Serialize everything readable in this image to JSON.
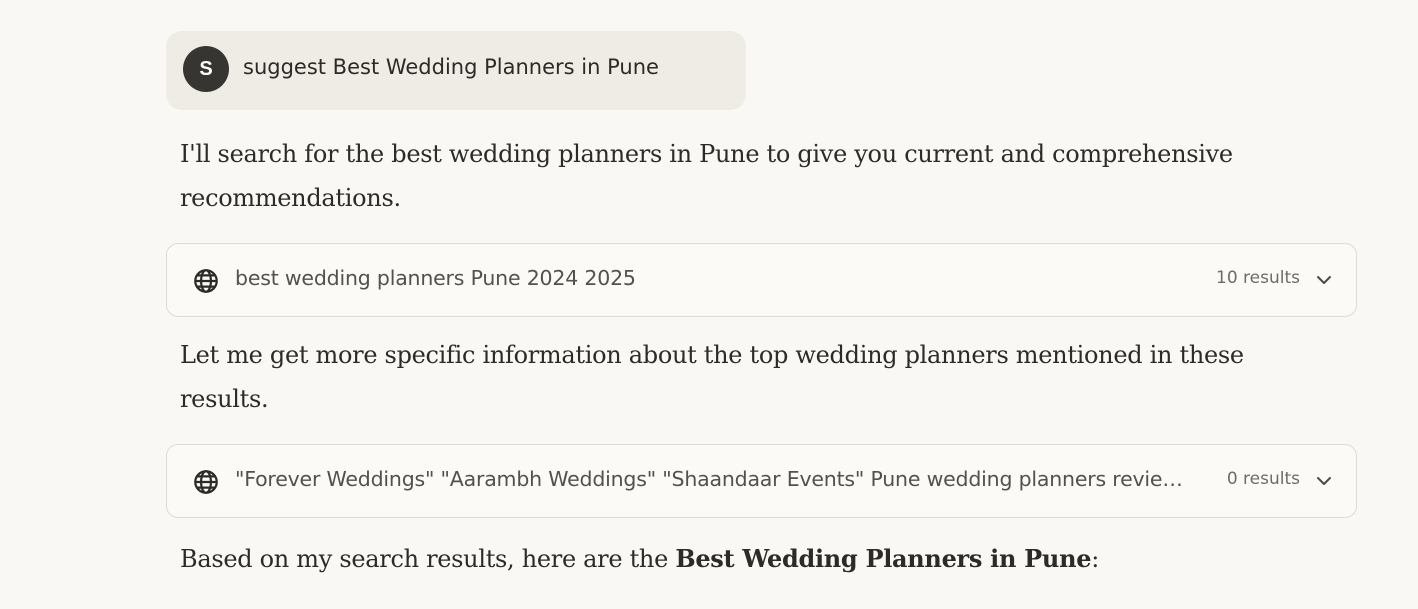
{
  "user_message": {
    "avatar_initial": "S",
    "text": "suggest Best Wedding Planners in Pune"
  },
  "assistant": {
    "intro": "I'll search for the best wedding planners in Pune to give you current and comprehensive recommendations.",
    "followup": "Let me get more specific information about the top wedding planners mentioned in these results.",
    "summary_prefix": "Based on my search results, here are the ",
    "summary_bold": "Best Wedding Planners in Pune",
    "summary_suffix": ":"
  },
  "searches": [
    {
      "query": "best wedding planners Pune 2024 2025",
      "results": "10 results",
      "icon": "globe-icon"
    },
    {
      "query": "\"Forever Weddings\" \"Aarambh Weddings\" \"Shaandaar Events\" Pune wedding planners reviews",
      "results": "0 results",
      "icon": "globe-icon"
    }
  ],
  "colors": {
    "background": "#f9f8f4",
    "user_bubble": "#efece5",
    "avatar": "#363532",
    "card_border": "#dedbd3"
  }
}
